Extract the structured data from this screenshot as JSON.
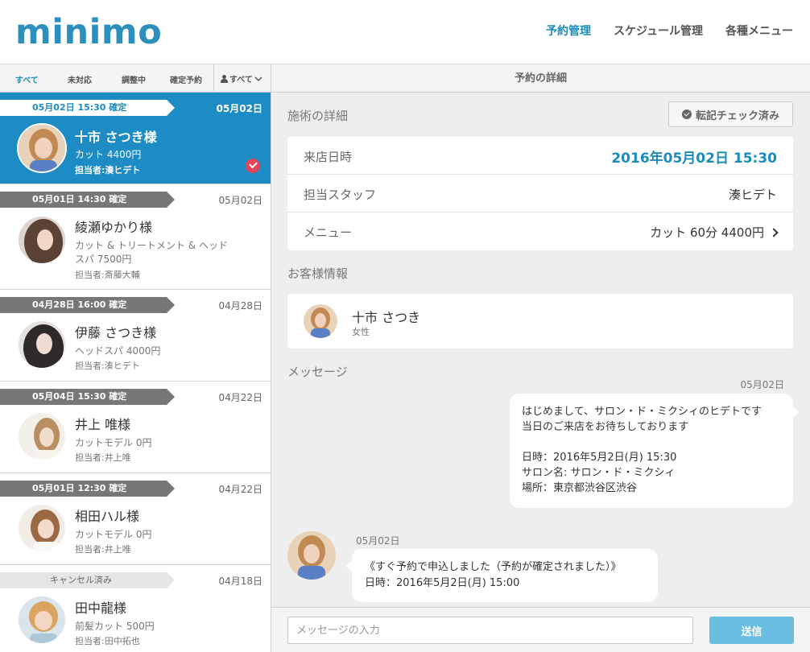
{
  "header": {
    "logo": "minimo",
    "nav": [
      {
        "label": "予約管理",
        "active": true
      },
      {
        "label": "スケジュール管理",
        "active": false
      },
      {
        "label": "各種メニュー",
        "active": false
      }
    ]
  },
  "filters": {
    "tabs": [
      "すべて",
      "未対応",
      "調整中",
      "確定予約"
    ],
    "staff": "すべて"
  },
  "reservations": [
    {
      "tag": "05月02日 15:30 確定",
      "date": "05月02日",
      "name": "十市 さつき様",
      "menu": "カット 4400円",
      "staff": "担当者:湊ヒデト",
      "selected": true,
      "checked": true
    },
    {
      "tag": "05月01日 14:30 確定",
      "date": "05月02日",
      "name": "綾瀬ゆかり様",
      "menu": "カット & トリートメント & ヘッドスパ 7500円",
      "staff": "担当者:斎藤大輔"
    },
    {
      "tag": "04月28日 16:00 確定",
      "date": "04月28日",
      "name": "伊藤 さつき様",
      "menu": "ヘッドスパ 4000円",
      "staff": "担当者:湊ヒデト"
    },
    {
      "tag": "05月04日 15:30 確定",
      "date": "04月22日",
      "name": "井上 唯様",
      "menu": "カットモデル 0円",
      "staff": "担当者:井上唯"
    },
    {
      "tag": "05月01日 12:30 確定",
      "date": "04月22日",
      "name": "相田ハル様",
      "menu": "カットモデル 0円",
      "staff": "担当者:井上唯"
    },
    {
      "tag": "キャンセル済み",
      "date": "04月18日",
      "name": "田中龍様",
      "menu": "前髪カット 500円",
      "staff": "担当者:田中拓也",
      "cancelled": true
    }
  ],
  "detail": {
    "header": "予約の詳細",
    "treatment_title": "施術の詳細",
    "transfer_button": "転記チェック済み",
    "rows": [
      {
        "label": "来店日時",
        "value": "2016年05月02日 15:30"
      },
      {
        "label": "担当スタッフ",
        "value": "湊ヒデト"
      },
      {
        "label": "メニュー",
        "value": "カット 60分 4400円"
      }
    ],
    "customer_title": "お客様情報",
    "customer": {
      "name": "十市 さつき",
      "gender": "女性"
    },
    "message_title": "メッセージ"
  },
  "messages": {
    "outgoing": {
      "date": "05月02日",
      "lines": [
        "はじめまして、サロン・ド・ミクシィのヒデトです",
        "当日のご来店をお待ちしております",
        "",
        "日時：2016年5月2日(月) 15:30",
        "サロン名: サロン・ド・ミクシィ",
        "場所：東京都渋谷区渋谷"
      ]
    },
    "incoming": {
      "date": "05月02日",
      "lines": [
        "《すぐ予約で申込しました（予約が確定されました）》",
        "日時：2016年5月2日(月) 15:00"
      ]
    }
  },
  "composer": {
    "placeholder": "メッセージの入力",
    "send": "送信"
  },
  "colors": {
    "brand": "#2c8fbd",
    "accent": "#1d8cc4",
    "send": "#68bde0",
    "check": "#e5445b"
  }
}
